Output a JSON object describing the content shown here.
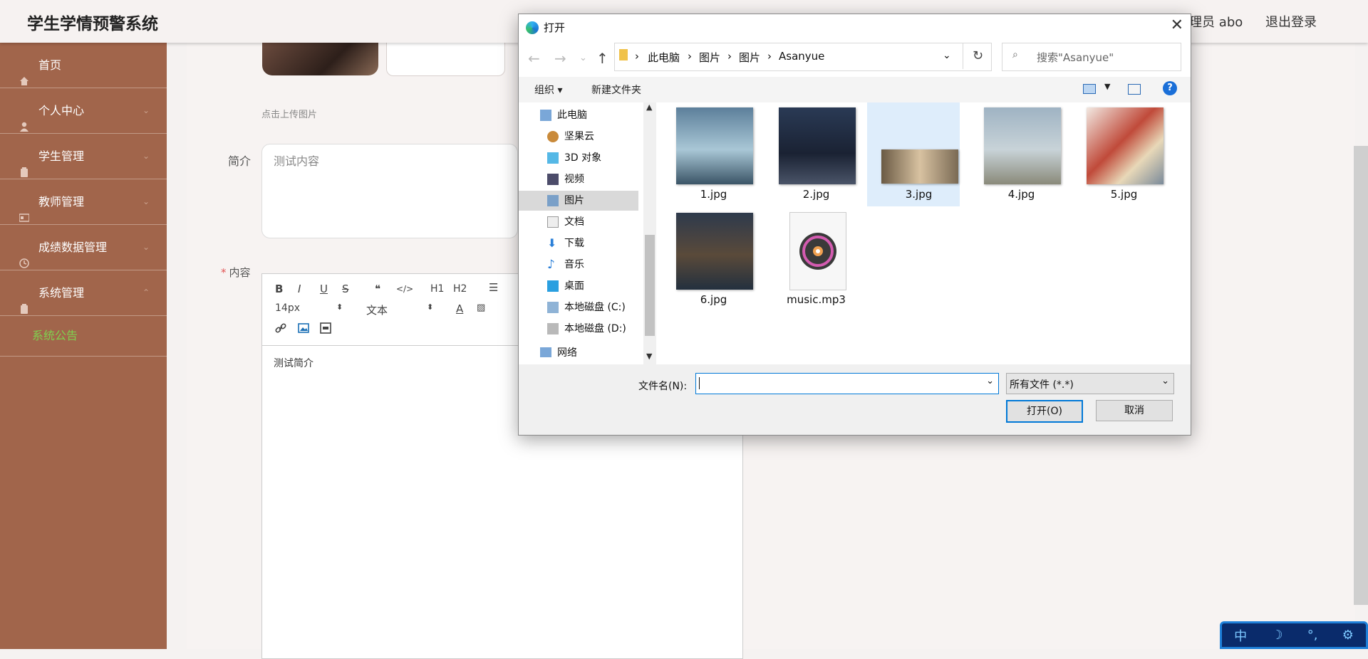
{
  "app": {
    "title": "学生学情预警系统",
    "user_label": "管理员 abo",
    "logout_label": "退出登录"
  },
  "sidebar": {
    "items": [
      {
        "label": "首页",
        "icon": "home-icon"
      },
      {
        "label": "个人中心",
        "icon": "user-icon"
      },
      {
        "label": "学生管理",
        "icon": "clipboard-icon"
      },
      {
        "label": "教师管理",
        "icon": "card-icon"
      },
      {
        "label": "成绩数据管理",
        "icon": "clock-icon"
      },
      {
        "label": "系统管理",
        "icon": "clipboard-icon"
      }
    ],
    "subitem": "系统公告",
    "active_color": "#7fd14f"
  },
  "form": {
    "upload_hint": "点击上传图片",
    "intro_label": "简介",
    "intro_value": "测试内容",
    "content_label": "内容",
    "editor": {
      "font_size": "14px",
      "paragraph": "文本",
      "body_text": "测试简介",
      "toolbar_buttons": [
        "B",
        "I",
        "U",
        "S",
        "❝",
        "</>",
        "H1",
        "H2"
      ]
    }
  },
  "dialog": {
    "title": "打开",
    "address": [
      "此电脑",
      "图片",
      "图片",
      "Asanyue"
    ],
    "search_placeholder": "搜索\"Asanyue\"",
    "organize_label": "组织",
    "new_folder_label": "新建文件夹",
    "tree": [
      "此电脑",
      "坚果云",
      "3D 对象",
      "视频",
      "图片",
      "文档",
      "下载",
      "音乐",
      "桌面",
      "本地磁盘 (C:)",
      "本地磁盘 (D:)",
      "网络"
    ],
    "selected_tree": "图片",
    "files": [
      {
        "name": "1.jpg",
        "selected": false
      },
      {
        "name": "2.jpg",
        "selected": false
      },
      {
        "name": "3.jpg",
        "selected": true
      },
      {
        "name": "4.jpg",
        "selected": false
      },
      {
        "name": "5.jpg",
        "selected": false
      },
      {
        "name": "6.jpg",
        "selected": false
      },
      {
        "name": "music.mp3",
        "selected": false
      }
    ],
    "filename_label": "文件名(N):",
    "filename_value": "",
    "filetype_value": "所有文件 (*.*)",
    "open_label": "打开(O)",
    "cancel_label": "取消"
  },
  "ime": {
    "items": [
      "中",
      "☽",
      "°,",
      "⚙"
    ]
  }
}
